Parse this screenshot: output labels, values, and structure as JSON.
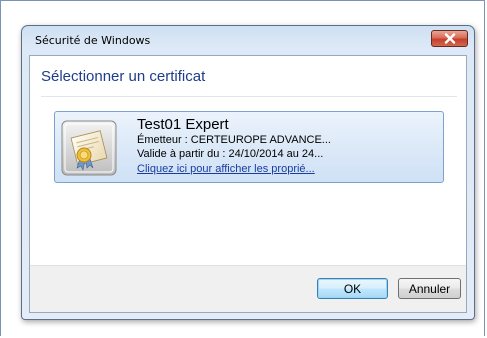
{
  "window": {
    "title": "Sécurité de Windows",
    "close_icon": "close-icon"
  },
  "dialog": {
    "heading": "Sélectionner un certificat"
  },
  "certificate": {
    "icon": "certificate-icon",
    "name": "Test01 Expert",
    "issuer": "Émetteur : CERTEUROPE ADVANCE...",
    "validity": "Valide à partir du : 24/10/2014 au 24...",
    "properties_link": "Cliquez ici pour afficher les proprié..."
  },
  "buttons": {
    "ok": "OK",
    "cancel": "Annuler"
  },
  "colors": {
    "heading": "#1e3c8c",
    "link": "#1a3c9e",
    "close_button": "#c5402b",
    "selection": "#dce9f8"
  }
}
